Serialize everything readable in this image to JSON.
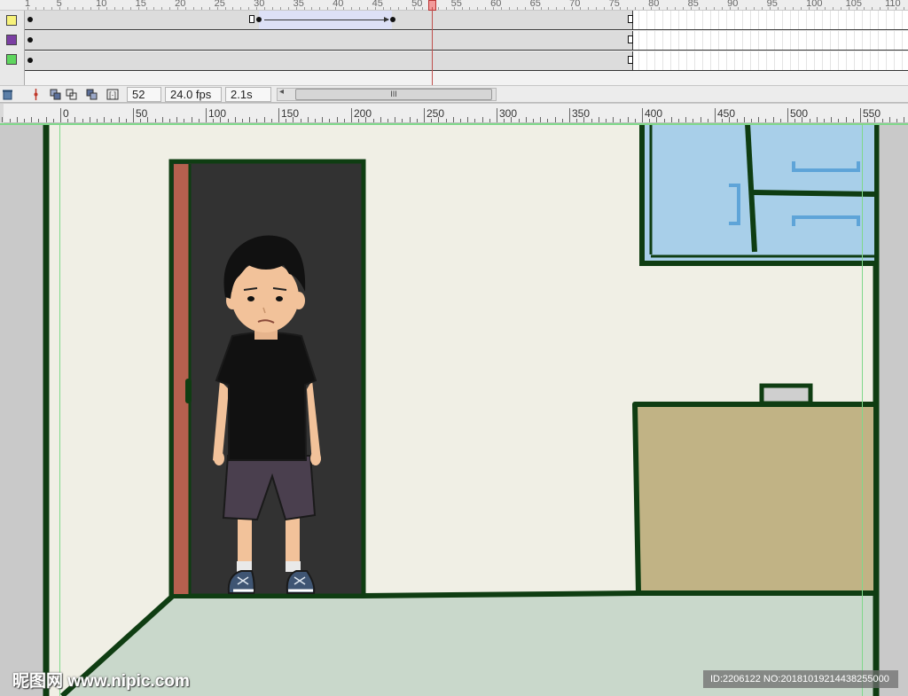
{
  "timeline": {
    "frame_numbers": [
      "1",
      "5",
      "10",
      "15",
      "20",
      "25",
      "30",
      "35",
      "40",
      "45",
      "50",
      "55",
      "60",
      "65",
      "70",
      "75",
      "80",
      "85",
      "90",
      "95",
      "100",
      "105",
      "110"
    ],
    "layers": [
      {
        "name": "",
        "color": "#f7f27a"
      },
      {
        "name": "",
        "color": "#7b3fa3"
      },
      {
        "name": "",
        "color": "#5fd65f"
      }
    ],
    "current_frame_marker": 52
  },
  "status_bar": {
    "frame": "52",
    "fps": "24.0 fps",
    "time": "2.1s",
    "scroll_thumb_glyph": "III",
    "scroll_left_glyph": "◂"
  },
  "ruler": {
    "labels": [
      "0",
      "50",
      "100",
      "150",
      "200",
      "250",
      "300",
      "350",
      "400",
      "450",
      "500",
      "550"
    ]
  },
  "stage": {
    "colors": {
      "wall": "#f0efe5",
      "floor": "#c9d8cb",
      "outline": "#0f3d12",
      "doorway": "#323232",
      "door_edge": "#b5604e",
      "window_glass": "#a8cfe9",
      "window_mark": "#5ea4d8",
      "cabinet": "#c1b385",
      "guide": "#7fd88a"
    }
  },
  "watermark": {
    "left": "昵图网 www.nipic.com",
    "right": "ID:2206122 NO:20181019214438255000"
  }
}
